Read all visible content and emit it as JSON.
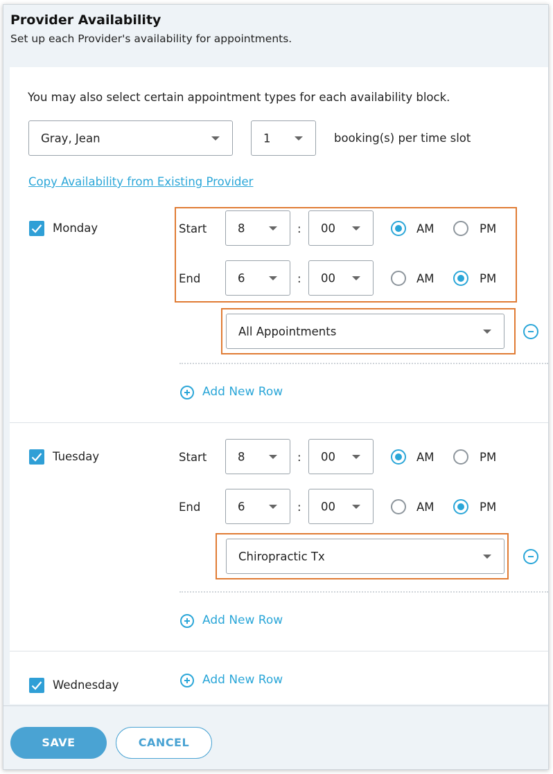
{
  "header": {
    "title": "Provider Availability",
    "subtitle": "Set up each Provider's availability for appointments."
  },
  "intro_text": "You may also select certain appointment types for each availability block.",
  "provider_select": {
    "value": "Gray, Jean"
  },
  "bookings_select": {
    "value": "1"
  },
  "bookings_label": "booking(s) per time slot",
  "copy_link": "Copy Availability from Existing Provider",
  "labels": {
    "start": "Start",
    "end": "End",
    "colon": ":",
    "am": "AM",
    "pm": "PM",
    "add_row": "Add New Row"
  },
  "days": [
    {
      "name": "Monday",
      "checked": true,
      "start": {
        "hour": "8",
        "minute": "00",
        "period": "AM"
      },
      "end": {
        "hour": "6",
        "minute": "00",
        "period": "PM"
      },
      "appointment_type": "All Appointments"
    },
    {
      "name": "Tuesday",
      "checked": true,
      "start": {
        "hour": "8",
        "minute": "00",
        "period": "AM"
      },
      "end": {
        "hour": "6",
        "minute": "00",
        "period": "PM"
      },
      "appointment_type": "Chiropractic Tx"
    },
    {
      "name": "Wednesday",
      "checked": true
    }
  ],
  "footer": {
    "save": "SAVE",
    "cancel": "CANCEL"
  },
  "colors": {
    "accent": "#2aa6d8",
    "highlight": "#e07b33",
    "save_button": "#4aa3d3"
  }
}
